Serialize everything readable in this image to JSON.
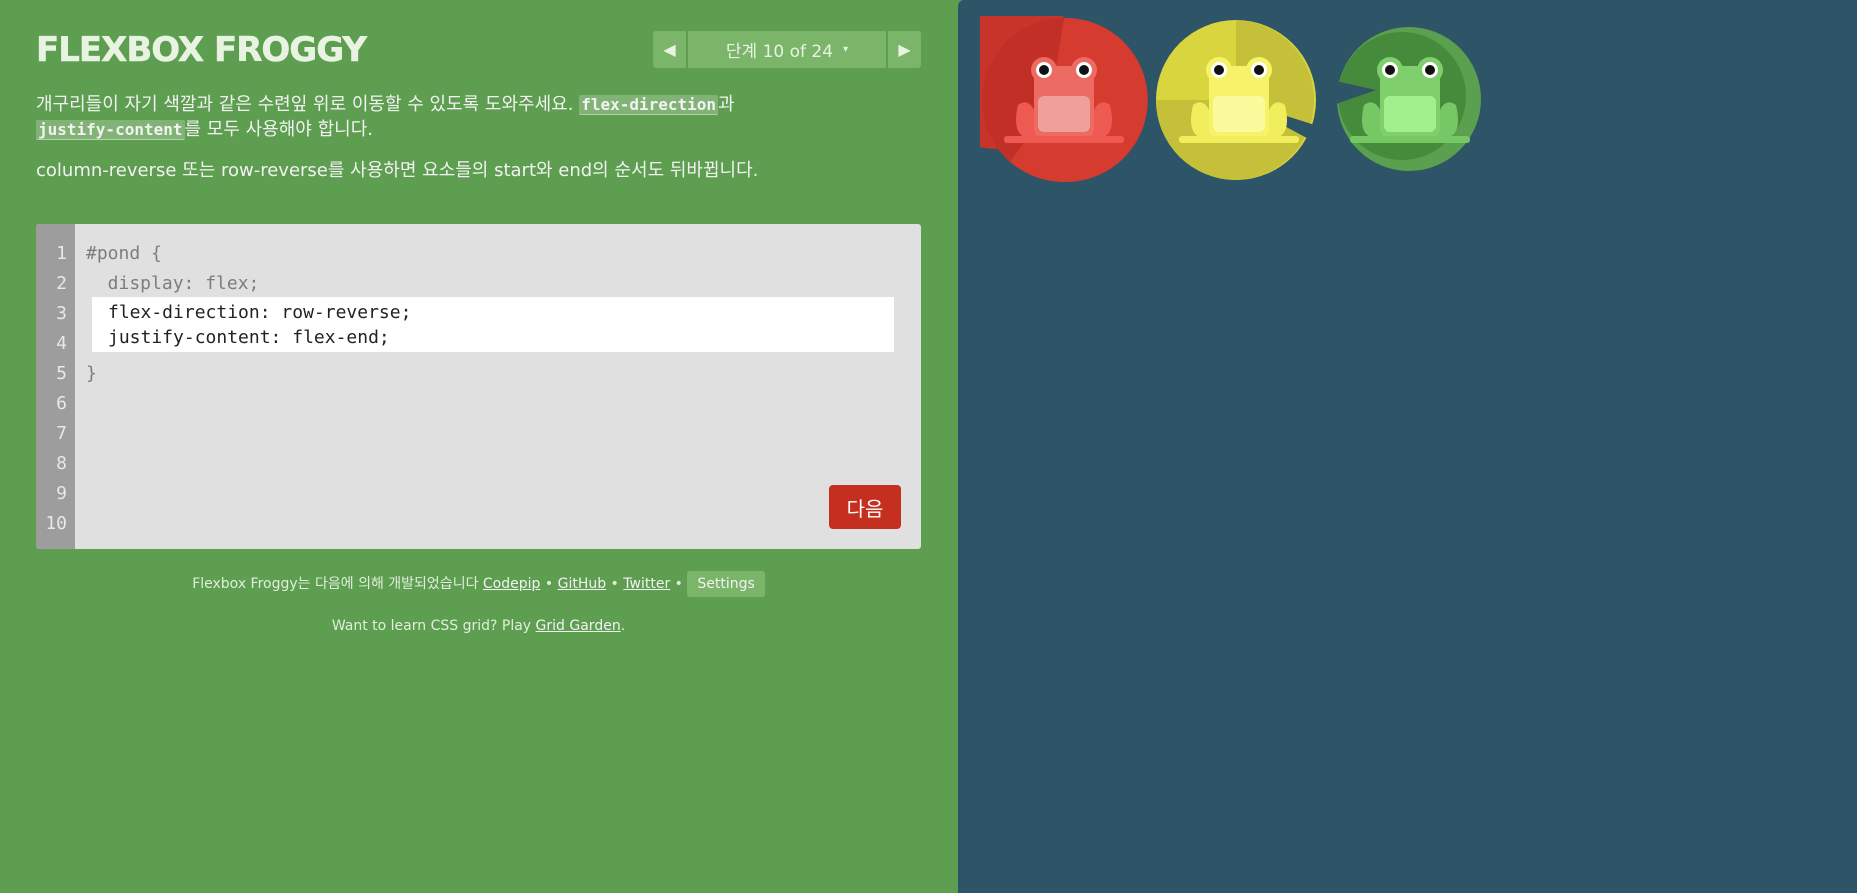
{
  "header": {
    "title": "FLEXBOX FROGGY",
    "level_label": "단계 10 of 24",
    "prev_symbol": "◀",
    "next_symbol": "▶",
    "caret_symbol": "▾"
  },
  "instructions": {
    "line1_before": "개구리들이 자기 색깔과 같은 수련잎 위로 이동할 수 있도록 도와주세요. ",
    "keyword1": "flex-direction",
    "connector": "과",
    "keyword2": "justify-content",
    "line1_after": "를 모두 사용해야 합니다.",
    "line2": "column-reverse 또는 row-reverse를 사용하면 요소들의 start와 end의 순서도 뒤바뀝니다."
  },
  "editor": {
    "line_numbers": [
      "1",
      "2",
      "3",
      "4",
      "5",
      "6",
      "7",
      "8",
      "9",
      "10"
    ],
    "line1": "#pond {",
    "line2": "  display: flex;",
    "line5": "}",
    "input_value": "flex-direction: row-reverse;\njustify-content: flex-end;",
    "next_label": "다음"
  },
  "footer": {
    "credits_prefix": "Flexbox Froggy는 다음에 의해 개발되었습니다 ",
    "codepip": "Codepip",
    "github": "GitHub",
    "twitter": "Twitter",
    "separator": " • ",
    "settings_label": "Settings",
    "promo_prefix": "Want to learn CSS grid? Play ",
    "promo_link": "Grid Garden",
    "promo_suffix": "."
  },
  "colors": {
    "sidebar_bg": "#5e9e50",
    "pond_bg": "#2e5567",
    "next_button": "#c52f1f",
    "red_pad": "#d63b2f",
    "yellow_pad": "#d9d53e",
    "green_pad": "#5a9e4b"
  },
  "pond": {
    "pads": [
      "red-lilypad",
      "yellow-lilypad",
      "green-lilypad"
    ],
    "frogs": [
      "red-frog",
      "yellow-frog",
      "green-frog"
    ]
  }
}
